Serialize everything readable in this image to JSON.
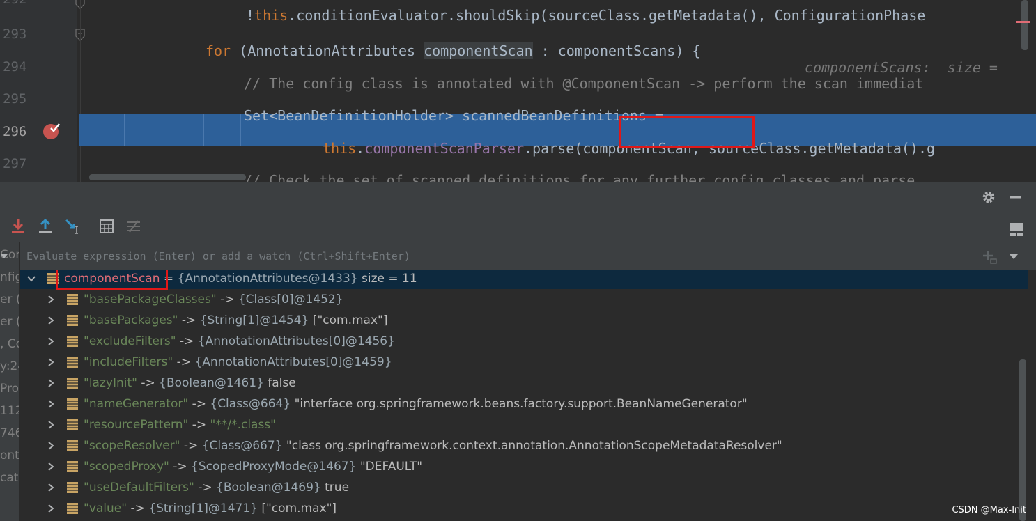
{
  "editor": {
    "line_numbers": [
      "292",
      "293",
      "294",
      "295",
      "296",
      "297"
    ],
    "line292": {
      "bang": "!",
      "this_kw": "this",
      "rest": ".conditionEvaluator.shouldSkip(sourceClass.getMetadata(), ConfigurationPhase"
    },
    "line293": {
      "for_kw": "for",
      "open": " (AnnotationAttributes ",
      "var": "componentScan",
      "rest": " : componentScans) {",
      "hint": "componentScans:  size ="
    },
    "line294": {
      "comment": "// The config class is annotated with @ComponentScan -> perform the scan immediat"
    },
    "line295": {
      "code": "Set<BeanDefinitionHolder> scannedBeanDefinitions ="
    },
    "line296": {
      "this_kw": "this",
      "dot1": ".",
      "field": "componentScanParser",
      "mid": ".parse(",
      "arg": "componentScan",
      "rest": ", sourceClass.getMetadata().g"
    },
    "line297": {
      "comment": "// Check the set of scanned definitions for any further config classes and parse"
    }
  },
  "debug": {
    "eval_placeholder": "Evaluate expression (Enter) or add a watch (Ctrl+Shift+Enter)",
    "frames": [
      "Cor",
      "nfig",
      "er (",
      "er (",
      ", Co",
      "y:24",
      "Pro",
      "112",
      "746",
      "onte",
      "cati"
    ],
    "root": {
      "name": "componentScan",
      "eq": " = ",
      "type": "{AnnotationAttributes@1433}",
      "value": " size = 11"
    },
    "children": [
      {
        "key": "\"basePackageClasses\"",
        "arrow": " -> ",
        "type": "{Class[0]@1452}",
        "value": ""
      },
      {
        "key": "\"basePackages\"",
        "arrow": " -> ",
        "type": "{String[1]@1454}",
        "value": " [\"com.max\"]"
      },
      {
        "key": "\"excludeFilters\"",
        "arrow": " -> ",
        "type": "{AnnotationAttributes[0]@1456}",
        "value": ""
      },
      {
        "key": "\"includeFilters\"",
        "arrow": " -> ",
        "type": "{AnnotationAttributes[0]@1459}",
        "value": ""
      },
      {
        "key": "\"lazyInit\"",
        "arrow": " -> ",
        "type": "{Boolean@1461}",
        "value": " false"
      },
      {
        "key": "\"nameGenerator\"",
        "arrow": " -> ",
        "type": "{Class@664}",
        "value": " \"interface org.springframework.beans.factory.support.BeanNameGenerator\""
      },
      {
        "key": "\"resourcePattern\"",
        "arrow": " -> ",
        "type": "",
        "value": "\"**/*.class\""
      },
      {
        "key": "\"scopeResolver\"",
        "arrow": " -> ",
        "type": "{Class@667}",
        "value": " \"class org.springframework.context.annotation.AnnotationScopeMetadataResolver\""
      },
      {
        "key": "\"scopedProxy\"",
        "arrow": " -> ",
        "type": "{ScopedProxyMode@1467}",
        "value": " \"DEFAULT\""
      },
      {
        "key": "\"useDefaultFilters\"",
        "arrow": " -> ",
        "type": "{Boolean@1469}",
        "value": " true"
      },
      {
        "key": "\"value\"",
        "arrow": " -> ",
        "type": "{String[1]@1471}",
        "value": " [\"com.max\"]"
      }
    ]
  },
  "watermark": "CSDN @Max-Init",
  "colors": {
    "accent_red": "#e01818",
    "breakpoint_line": "#2d6099",
    "selected_row": "#0d293e"
  },
  "icons": [
    "settings-icon",
    "minimize-icon",
    "step-into-icon",
    "step-out-icon",
    "run-to-cursor-icon",
    "evaluate-icon",
    "trace-icon",
    "layout-icon",
    "add-watch-icon",
    "dropdown-icon",
    "breakpoint-icon",
    "fold-icon",
    "chevron-right-icon",
    "chevron-down-icon",
    "field-icon"
  ]
}
